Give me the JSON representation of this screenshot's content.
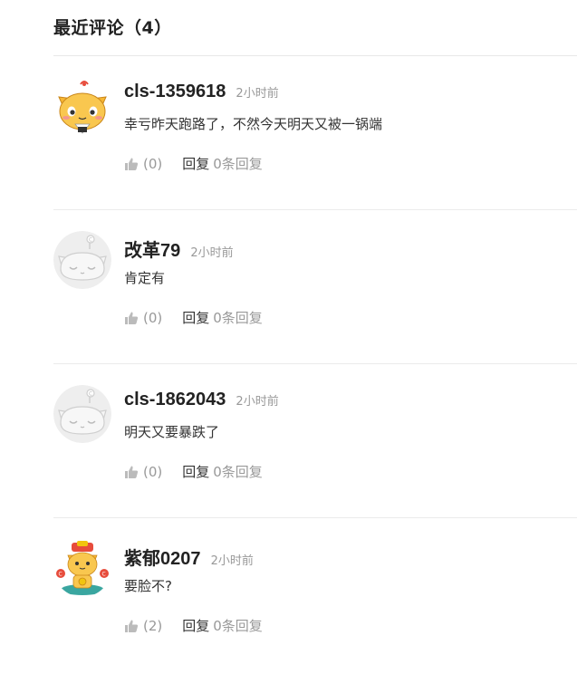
{
  "header": {
    "title": "最近评论",
    "count": "（4）"
  },
  "comments": [
    {
      "username": "cls-1359618",
      "time": "2小时前",
      "content": "幸亏昨天跑路了，不然今天明天又被一锅端",
      "likes": "(0)",
      "reply_label": "回复",
      "reply_count": "0条回复",
      "avatar": "cat-rice-ball-avatar"
    },
    {
      "username": "改革79",
      "time": "2小时前",
      "content": "肯定有",
      "likes": "(0)",
      "reply_label": "回复",
      "reply_count": "0条回复",
      "avatar": "default-cat-avatar"
    },
    {
      "username": "cls-1862043",
      "time": "2小时前",
      "content": "明天又要暴跌了",
      "likes": "(0)",
      "reply_label": "回复",
      "reply_count": "0条回复",
      "avatar": "default-cat-avatar"
    },
    {
      "username": "紫郁0207",
      "time": "2小时前",
      "content": "要脸不?",
      "likes": "(2)",
      "reply_label": "回复",
      "reply_count": "0条回复",
      "avatar": "fortune-cat-avatar"
    }
  ],
  "colors": {
    "text_primary": "#222222",
    "text_muted": "#999999",
    "divider": "#ebebeb",
    "cat_orange": "#f7b733"
  }
}
